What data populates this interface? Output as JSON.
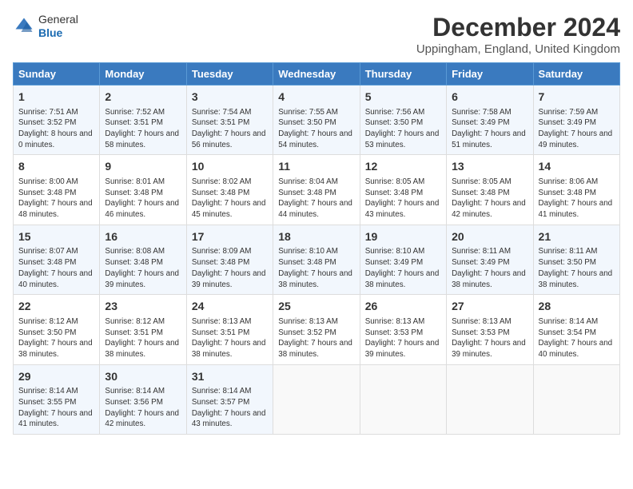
{
  "header": {
    "logo_general": "General",
    "logo_blue": "Blue",
    "title": "December 2024",
    "location": "Uppingham, England, United Kingdom"
  },
  "weekdays": [
    "Sunday",
    "Monday",
    "Tuesday",
    "Wednesday",
    "Thursday",
    "Friday",
    "Saturday"
  ],
  "weeks": [
    [
      {
        "day": "1",
        "sunrise": "Sunrise: 7:51 AM",
        "sunset": "Sunset: 3:52 PM",
        "daylight": "Daylight: 8 hours and 0 minutes."
      },
      {
        "day": "2",
        "sunrise": "Sunrise: 7:52 AM",
        "sunset": "Sunset: 3:51 PM",
        "daylight": "Daylight: 7 hours and 58 minutes."
      },
      {
        "day": "3",
        "sunrise": "Sunrise: 7:54 AM",
        "sunset": "Sunset: 3:51 PM",
        "daylight": "Daylight: 7 hours and 56 minutes."
      },
      {
        "day": "4",
        "sunrise": "Sunrise: 7:55 AM",
        "sunset": "Sunset: 3:50 PM",
        "daylight": "Daylight: 7 hours and 54 minutes."
      },
      {
        "day": "5",
        "sunrise": "Sunrise: 7:56 AM",
        "sunset": "Sunset: 3:50 PM",
        "daylight": "Daylight: 7 hours and 53 minutes."
      },
      {
        "day": "6",
        "sunrise": "Sunrise: 7:58 AM",
        "sunset": "Sunset: 3:49 PM",
        "daylight": "Daylight: 7 hours and 51 minutes."
      },
      {
        "day": "7",
        "sunrise": "Sunrise: 7:59 AM",
        "sunset": "Sunset: 3:49 PM",
        "daylight": "Daylight: 7 hours and 49 minutes."
      }
    ],
    [
      {
        "day": "8",
        "sunrise": "Sunrise: 8:00 AM",
        "sunset": "Sunset: 3:48 PM",
        "daylight": "Daylight: 7 hours and 48 minutes."
      },
      {
        "day": "9",
        "sunrise": "Sunrise: 8:01 AM",
        "sunset": "Sunset: 3:48 PM",
        "daylight": "Daylight: 7 hours and 46 minutes."
      },
      {
        "day": "10",
        "sunrise": "Sunrise: 8:02 AM",
        "sunset": "Sunset: 3:48 PM",
        "daylight": "Daylight: 7 hours and 45 minutes."
      },
      {
        "day": "11",
        "sunrise": "Sunrise: 8:04 AM",
        "sunset": "Sunset: 3:48 PM",
        "daylight": "Daylight: 7 hours and 44 minutes."
      },
      {
        "day": "12",
        "sunrise": "Sunrise: 8:05 AM",
        "sunset": "Sunset: 3:48 PM",
        "daylight": "Daylight: 7 hours and 43 minutes."
      },
      {
        "day": "13",
        "sunrise": "Sunrise: 8:05 AM",
        "sunset": "Sunset: 3:48 PM",
        "daylight": "Daylight: 7 hours and 42 minutes."
      },
      {
        "day": "14",
        "sunrise": "Sunrise: 8:06 AM",
        "sunset": "Sunset: 3:48 PM",
        "daylight": "Daylight: 7 hours and 41 minutes."
      }
    ],
    [
      {
        "day": "15",
        "sunrise": "Sunrise: 8:07 AM",
        "sunset": "Sunset: 3:48 PM",
        "daylight": "Daylight: 7 hours and 40 minutes."
      },
      {
        "day": "16",
        "sunrise": "Sunrise: 8:08 AM",
        "sunset": "Sunset: 3:48 PM",
        "daylight": "Daylight: 7 hours and 39 minutes."
      },
      {
        "day": "17",
        "sunrise": "Sunrise: 8:09 AM",
        "sunset": "Sunset: 3:48 PM",
        "daylight": "Daylight: 7 hours and 39 minutes."
      },
      {
        "day": "18",
        "sunrise": "Sunrise: 8:10 AM",
        "sunset": "Sunset: 3:48 PM",
        "daylight": "Daylight: 7 hours and 38 minutes."
      },
      {
        "day": "19",
        "sunrise": "Sunrise: 8:10 AM",
        "sunset": "Sunset: 3:49 PM",
        "daylight": "Daylight: 7 hours and 38 minutes."
      },
      {
        "day": "20",
        "sunrise": "Sunrise: 8:11 AM",
        "sunset": "Sunset: 3:49 PM",
        "daylight": "Daylight: 7 hours and 38 minutes."
      },
      {
        "day": "21",
        "sunrise": "Sunrise: 8:11 AM",
        "sunset": "Sunset: 3:50 PM",
        "daylight": "Daylight: 7 hours and 38 minutes."
      }
    ],
    [
      {
        "day": "22",
        "sunrise": "Sunrise: 8:12 AM",
        "sunset": "Sunset: 3:50 PM",
        "daylight": "Daylight: 7 hours and 38 minutes."
      },
      {
        "day": "23",
        "sunrise": "Sunrise: 8:12 AM",
        "sunset": "Sunset: 3:51 PM",
        "daylight": "Daylight: 7 hours and 38 minutes."
      },
      {
        "day": "24",
        "sunrise": "Sunrise: 8:13 AM",
        "sunset": "Sunset: 3:51 PM",
        "daylight": "Daylight: 7 hours and 38 minutes."
      },
      {
        "day": "25",
        "sunrise": "Sunrise: 8:13 AM",
        "sunset": "Sunset: 3:52 PM",
        "daylight": "Daylight: 7 hours and 38 minutes."
      },
      {
        "day": "26",
        "sunrise": "Sunrise: 8:13 AM",
        "sunset": "Sunset: 3:53 PM",
        "daylight": "Daylight: 7 hours and 39 minutes."
      },
      {
        "day": "27",
        "sunrise": "Sunrise: 8:13 AM",
        "sunset": "Sunset: 3:53 PM",
        "daylight": "Daylight: 7 hours and 39 minutes."
      },
      {
        "day": "28",
        "sunrise": "Sunrise: 8:14 AM",
        "sunset": "Sunset: 3:54 PM",
        "daylight": "Daylight: 7 hours and 40 minutes."
      }
    ],
    [
      {
        "day": "29",
        "sunrise": "Sunrise: 8:14 AM",
        "sunset": "Sunset: 3:55 PM",
        "daylight": "Daylight: 7 hours and 41 minutes."
      },
      {
        "day": "30",
        "sunrise": "Sunrise: 8:14 AM",
        "sunset": "Sunset: 3:56 PM",
        "daylight": "Daylight: 7 hours and 42 minutes."
      },
      {
        "day": "31",
        "sunrise": "Sunrise: 8:14 AM",
        "sunset": "Sunset: 3:57 PM",
        "daylight": "Daylight: 7 hours and 43 minutes."
      },
      null,
      null,
      null,
      null
    ]
  ]
}
